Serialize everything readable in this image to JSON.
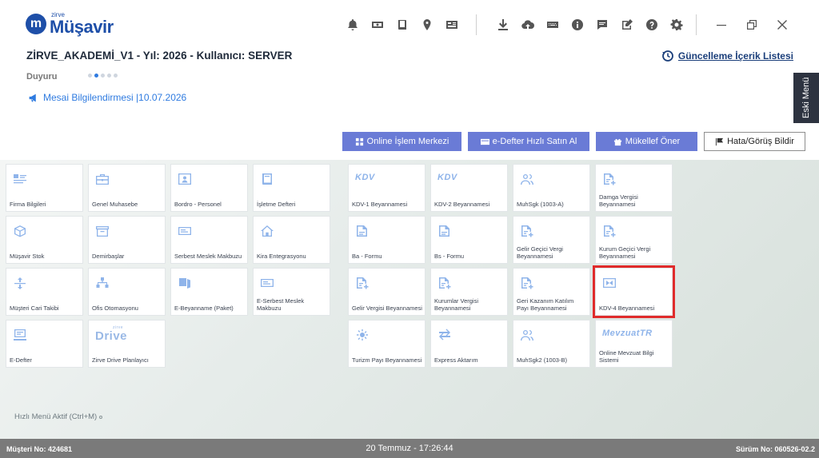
{
  "logo": {
    "brand": "zirve",
    "name": "Müşavir",
    "mark": "m"
  },
  "header": {
    "title": "ZİRVE_AKADEMİ_V1 - Yıl: 2026 - Kullanıcı: SERVER",
    "update_link": "Güncelleme İçerik Listesi",
    "duyuru_label": "Duyuru",
    "announcement": "Mesai Bilgilendirmesi |10.07.2026",
    "side_tab": "Eski Menü"
  },
  "actions": {
    "online": "Online İşlem Merkezi",
    "edefter": "e-Defter Hızlı Satın Al",
    "mukellef": "Mükellef Öner",
    "hata": "Hata/Görüş Bildir"
  },
  "tiles_left": [
    {
      "label": "Firma Bilgileri",
      "icon": "list-card-icon"
    },
    {
      "label": "Genel Muhasebe",
      "icon": "briefcase-icon"
    },
    {
      "label": "Bordro - Personel",
      "icon": "id-card-icon"
    },
    {
      "label": "İşletme Defteri",
      "icon": "book-icon"
    },
    {
      "label": "Müşavir Stok",
      "icon": "cube-icon"
    },
    {
      "label": "Demirbaşlar",
      "icon": "box-icon"
    },
    {
      "label": "Serbest Meslek Makbuzu",
      "icon": "receipt-icon"
    },
    {
      "label": "Kira Entegrasyonu",
      "icon": "home-icon"
    },
    {
      "label": "Müşteri Cari Takibi",
      "icon": "transfer-icon"
    },
    {
      "label": "Ofis Otomasyonu",
      "icon": "org-chart-icon"
    },
    {
      "label": "E-Beyanname (Paket)",
      "icon": "package-icon"
    },
    {
      "label": "E-Serbest Meslek Makbuzu",
      "icon": "receipt-icon"
    },
    {
      "label": "E-Defter",
      "icon": "ledger-icon"
    },
    {
      "label": "Zirve Drive Planlayıcı",
      "logo": "Drive",
      "logo_small": "zirve"
    }
  ],
  "tiles_right": [
    {
      "label": "KDV-1 Beyannamesi",
      "logo": "KDV"
    },
    {
      "label": "KDV-2 Beyannamesi",
      "logo": "KDV"
    },
    {
      "label": "MuhSgk (1003-A)",
      "icon": "users-icon"
    },
    {
      "label": "Damga Vergisi Beyannamesi",
      "icon": "doc-plus-icon"
    },
    {
      "label": "Ba - Formu",
      "icon": "doc-icon"
    },
    {
      "label": "Bs - Formu",
      "icon": "doc-icon"
    },
    {
      "label": "Gelir Geçici Vergi Beyannamesi",
      "icon": "doc-plus-icon"
    },
    {
      "label": "Kurum Geçici Vergi Beyannamesi",
      "icon": "doc-plus-icon"
    },
    {
      "label": "Gelir Vergisi Beyannamesi",
      "icon": "doc-plus-icon"
    },
    {
      "label": "Kurumlar Vergisi Beyannamesi",
      "icon": "doc-plus-icon"
    },
    {
      "label": "Geri Kazanım Katılım Payı Beyannamesi",
      "icon": "doc-plus-icon"
    },
    {
      "label": "KDV-4 Beyannamesi",
      "icon": "kdv4-icon",
      "highlight": true
    },
    {
      "label": "Turizm Payı Beyannamesi",
      "icon": "sun-icon"
    },
    {
      "label": "Express Aktarım",
      "icon": "swap-icon"
    },
    {
      "label": "MuhSgk2 (1003-B)",
      "icon": "users-icon"
    },
    {
      "label": "Online Mevzuat Bilgi Sistemi",
      "logo": "MevzuatTR"
    }
  ],
  "quick_menu": "Hızlı Menü Aktif (Ctrl+M)",
  "status": {
    "customer": "Müşteri No: 424681",
    "datetime": "20 Temmuz - 17:26:44",
    "version": "Sürüm No: 060526-02.2"
  },
  "colors": {
    "primary": "#1e4fa8",
    "accent": "#2f7be0",
    "button": "#6a7bd6",
    "highlight": "#e02b2b",
    "statusbar": "#7a7a7a"
  }
}
